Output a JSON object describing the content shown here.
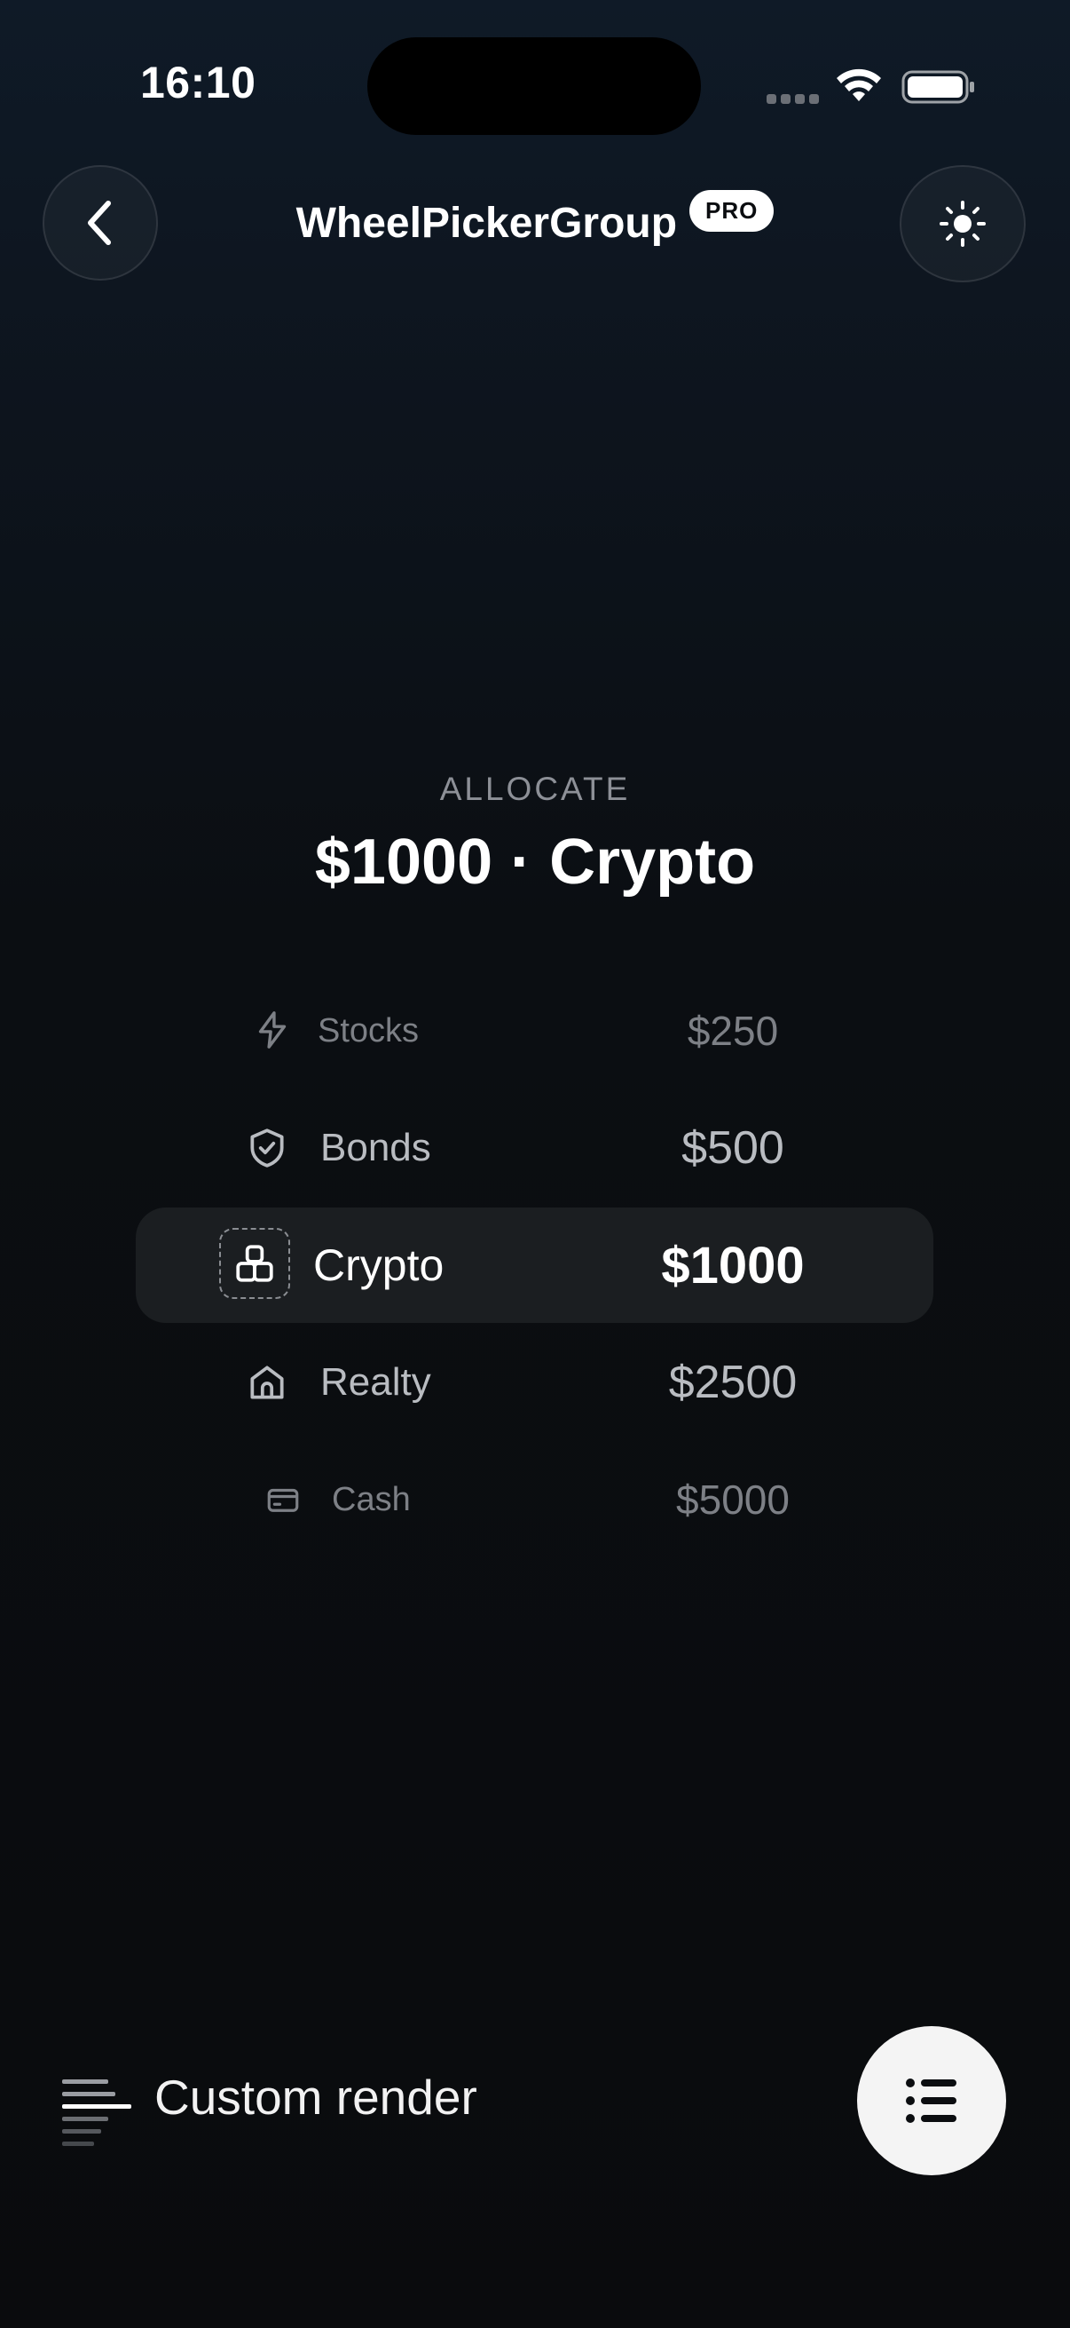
{
  "status_bar": {
    "time": "16:10"
  },
  "header": {
    "title": "WheelPickerGroup",
    "badge": "PRO",
    "back_icon": "chevron-left-icon",
    "theme_icon": "sun-icon"
  },
  "allocation": {
    "label": "ALLOCATE",
    "summary": "$1000 · Crypto"
  },
  "wheel": {
    "selected_index": 2,
    "items": [
      {
        "label": "Stocks",
        "value": "$250",
        "icon": "lightning-icon"
      },
      {
        "label": "Bonds",
        "value": "$500",
        "icon": "shield-check-icon"
      },
      {
        "label": "Crypto",
        "value": "$1000",
        "icon": "blocks-icon"
      },
      {
        "label": "Realty",
        "value": "$2500",
        "icon": "home-icon"
      },
      {
        "label": "Cash",
        "value": "$5000",
        "icon": "credit-card-icon"
      }
    ]
  },
  "footer": {
    "mode_label": "Custom render",
    "mode_icon": "text-lines-icon",
    "menu_icon": "list-icon"
  },
  "colors": {
    "background": "#0b0d10",
    "highlight": "#1b1e21",
    "fab": "#f4f4f4"
  }
}
